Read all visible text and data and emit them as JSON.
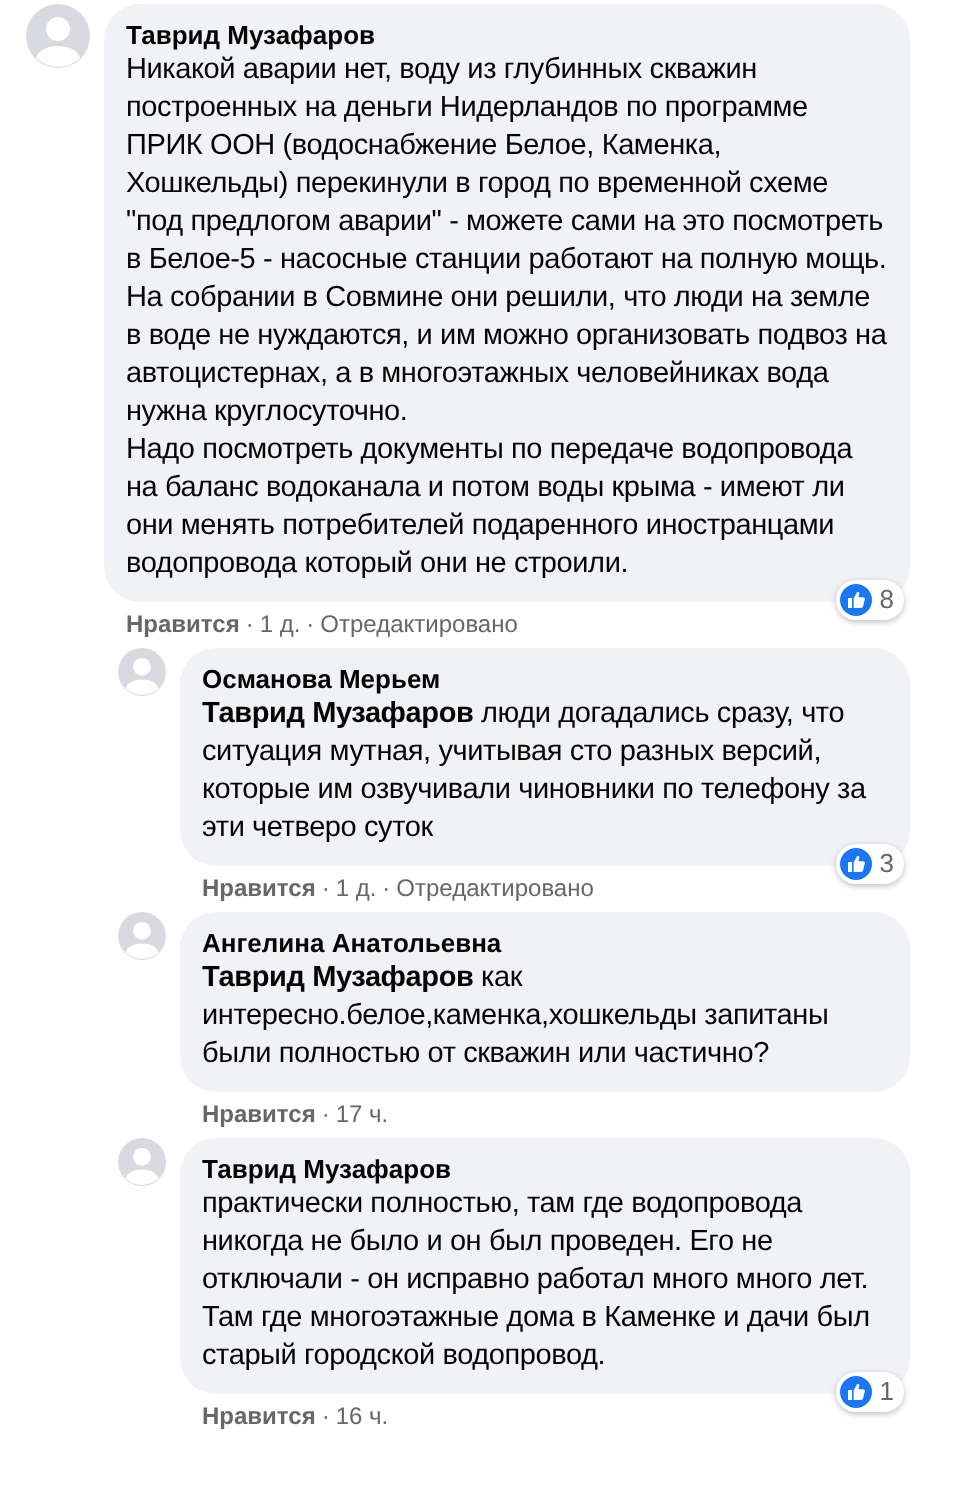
{
  "comments": [
    {
      "kind": "top",
      "author": "Таврид Музафаров",
      "paragraphs": [
        "Никакой аварии нет, воду из глубинных скважин построенных на деньги Нидерландов по программе ПРИК ООН (водоснабжение Белое, Каменка, Хошкельды) перекинули в город по временной схеме \"под предлогом аварии\" - можете сами на это посмотреть в Белое-5 - насосные станции работают на полную мощь.",
        "На собрании в Совмине они решили, что люди на земле в воде не нуждаются, и им можно организовать подвоз на автоцистернах, а в многоэтажных человейниках вода нужна круглосуточно.",
        "Надо посмотреть документы по передаче водопровода на баланс водоканала и потом воды крыма - имеют ли они менять потребителей подаренного иностранцами водопровода который они не строили."
      ],
      "reactions": "8",
      "like": "Нравится",
      "separator": "·",
      "time": "1 д.",
      "edited": "Отредактировано"
    },
    {
      "kind": "reply",
      "author": "Османова Мерьем",
      "paragraphs": [
        "**Таврид Музафаров** люди догадались сразу, что ситуация мутная, учитывая сто разных версий, которые им озвучивали чиновники по телефону за эти четверо суток"
      ],
      "reactions": "3",
      "like": "Нравится",
      "separator": "·",
      "time": "1 д.",
      "edited": "Отредактировано"
    },
    {
      "kind": "reply",
      "author": "Ангелина Анатольевна",
      "paragraphs": [
        "**Таврид Музафаров** как интересно.белое,каменка,хошкельды запитаны были полностью от скважин или частично?"
      ],
      "like": "Нравится",
      "separator": "·",
      "time": "17 ч."
    },
    {
      "kind": "reply",
      "author": "Таврид Музафаров",
      "paragraphs": [
        "практически полностью, там где водопровода никогда не было и он был проведен. Его не отключали - он исправно работал много много лет. Там где многоэтажные дома в Каменке и дачи был старый городской водопровод."
      ],
      "reactions": "1",
      "like": "Нравится",
      "separator": "·",
      "time": "16 ч."
    }
  ]
}
